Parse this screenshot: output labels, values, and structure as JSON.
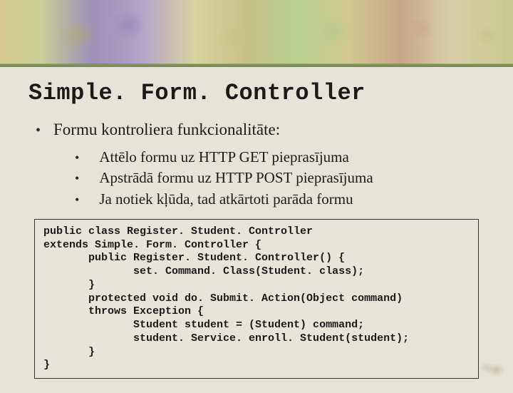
{
  "title": "Simple. Form. Controller",
  "main_bullet": "Formu kontroliera funkcionalitāte:",
  "sub_bullets": [
    "Attēlo formu uz HTTP GET pieprasījuma",
    "Apstrādā formu uz HTTP POST pieprasījuma",
    "Ja notiek kļūda, tad atkārtoti parāda formu"
  ],
  "code": "public class Register. Student. Controller\nextends Simple. Form. Controller {\n       public Register. Student. Controller() {\n              set. Command. Class(Student. class);\n       }\n       protected void do. Submit. Action(Object command)\n       throws Exception {\n              Student student = (Student) command;\n              student. Service. enroll. Student(student);\n       }\n}"
}
